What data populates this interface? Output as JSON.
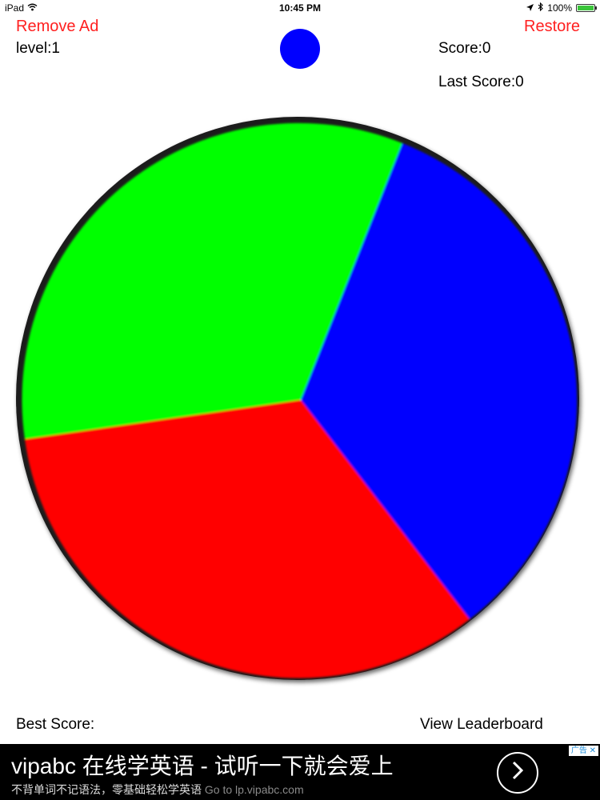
{
  "status_bar": {
    "device": "iPad",
    "time": "10:45 PM",
    "battery": "100%"
  },
  "header": {
    "remove_ad": "Remove Ad",
    "restore": "Restore",
    "level": "level:1",
    "score": "Score:0",
    "last_score": "Last Score:0"
  },
  "target_color": "#0000ff",
  "wheel": {
    "segments": [
      {
        "color": "green",
        "hex": "#00ff00"
      },
      {
        "color": "blue",
        "hex": "#0000ff"
      },
      {
        "color": "red",
        "hex": "#ff0000"
      }
    ]
  },
  "footer": {
    "best_score": "Best Score:",
    "leaderboard": "View Leaderboard"
  },
  "ad": {
    "title": "vipabc 在线学英语 - 试听一下就会爱上",
    "subtitle": "不背单词不记语法，零基础轻松学英语",
    "link": "Go to lp.vipabc.com",
    "badge": "广告",
    "button_icon": "chevron-right-icon"
  }
}
